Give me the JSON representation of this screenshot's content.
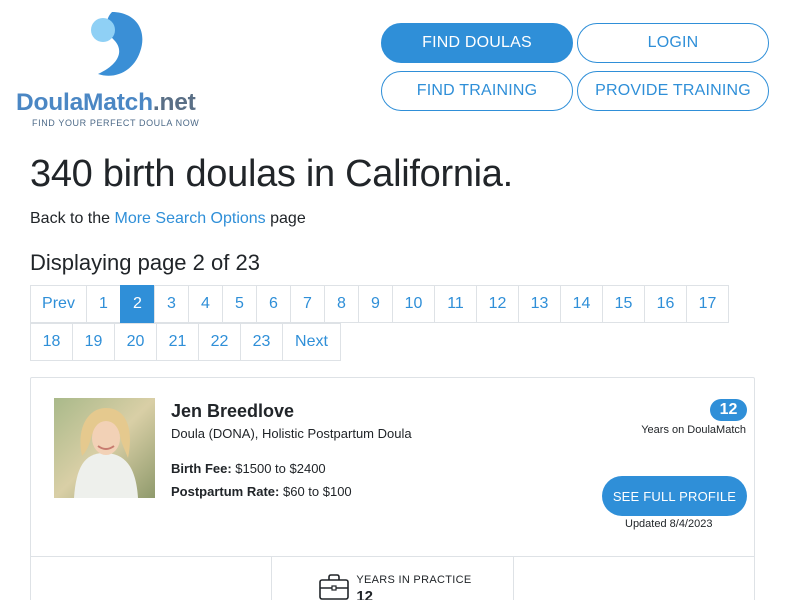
{
  "logo": {
    "brand_main": "DoulaMatch",
    "brand_tld": ".net",
    "tagline": "FIND YOUR PERFECT DOULA NOW"
  },
  "header": {
    "find_doulas": "FIND DOULAS",
    "login": "LOGIN",
    "find_training": "FIND TRAINING",
    "provide_training": "PROVIDE TRAINING"
  },
  "colors": {
    "accent": "#2f8fd8",
    "brand_blue": "#4b87c4",
    "border": "#dee2e6",
    "text": "#212529"
  },
  "results": {
    "title": "340 birth doulas in California.",
    "back_prefix": "Back to the ",
    "back_link": "More Search Options",
    "back_suffix": " page",
    "displaying": "Displaying page 2 of 23"
  },
  "pagination": {
    "current": "2",
    "row1": [
      "Prev",
      "1",
      "2",
      "3",
      "4",
      "5",
      "6",
      "7",
      "8",
      "9",
      "10",
      "11",
      "12",
      "13",
      "14",
      "15",
      "16",
      "17"
    ],
    "row2": [
      "18",
      "19",
      "20",
      "21",
      "22",
      "23",
      "Next"
    ]
  },
  "listing": {
    "name": "Jen Breedlove",
    "credentials": "Doula (DONA), Holistic Postpartum Doula",
    "birth_fee_label": "Birth Fee:",
    "birth_fee": "$1500 to $2400",
    "postpartum_rate_label": "Postpartum Rate:",
    "postpartum_rate": "$60 to $100",
    "years_on_site": "12",
    "years_on_site_label": "Years on DoulaMatch",
    "profile_button": "SEE FULL PROFILE",
    "updated": "Updated 8/4/2023",
    "stats": {
      "years_in_practice_label": "YEARS IN PRACTICE",
      "years_in_practice_value": "12"
    }
  }
}
